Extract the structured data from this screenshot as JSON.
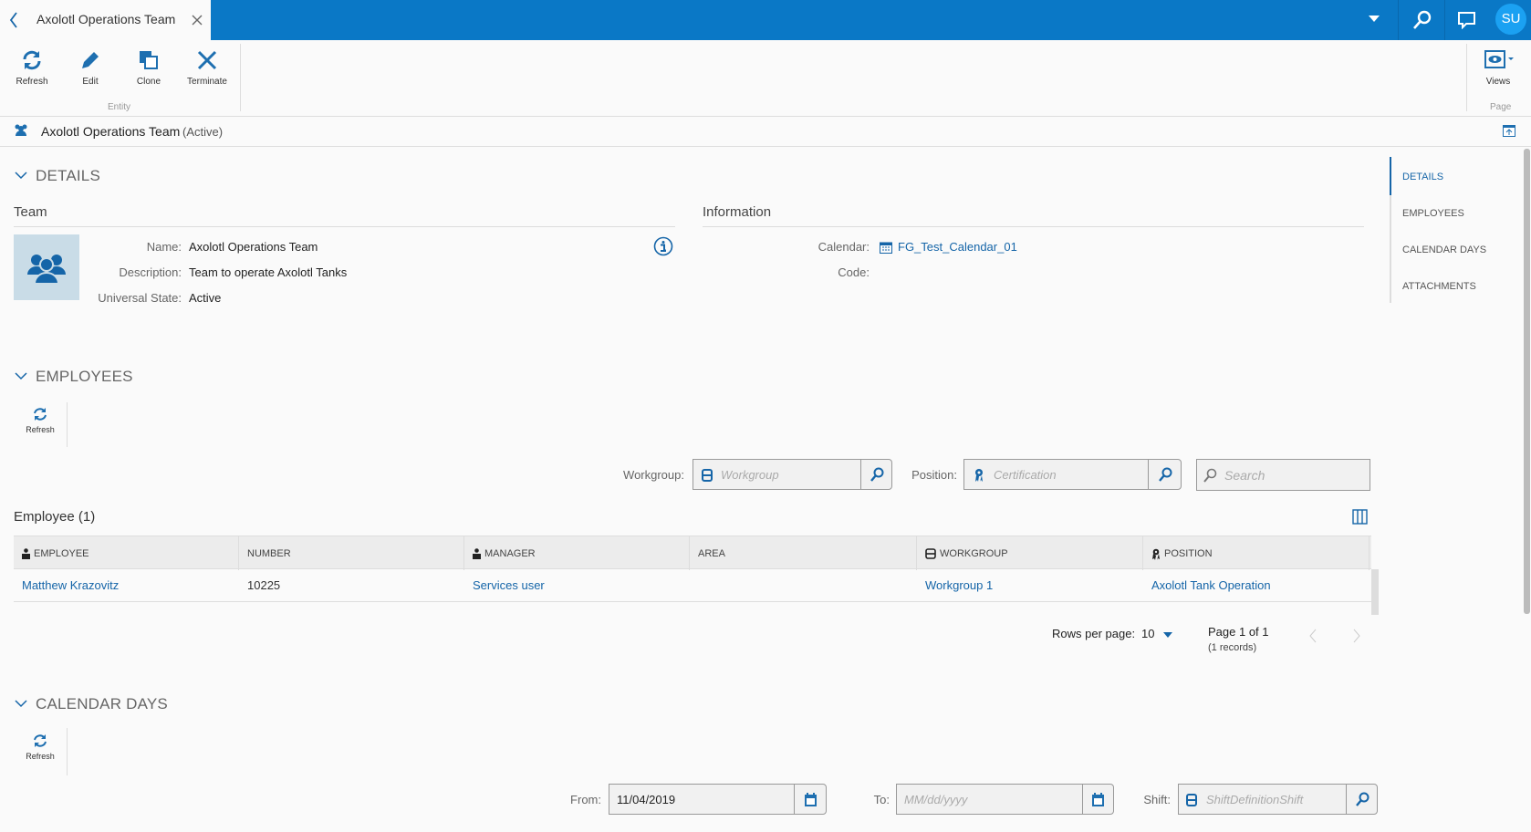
{
  "tab": {
    "title": "Axolotl Operations Team"
  },
  "user": {
    "initials": "SU"
  },
  "toolbar": {
    "refresh": "Refresh",
    "edit": "Edit",
    "clone": "Clone",
    "terminate": "Terminate",
    "entity_group": "Entity",
    "views": "Views",
    "page_group": "Page"
  },
  "header": {
    "title": "Axolotl Operations Team",
    "state": "(Active)"
  },
  "details": {
    "heading": "DETAILS",
    "team_heading": "Team",
    "info_heading": "Information",
    "name_label": "Name:",
    "name": "Axolotl Operations Team",
    "description_label": "Description:",
    "description": "Team to operate Axolotl Tanks",
    "state_label": "Universal State:",
    "state": "Active",
    "calendar_label": "Calendar:",
    "calendar": "FG_Test_Calendar_01",
    "code_label": "Code:"
  },
  "nav": {
    "items": [
      "DETAILS",
      "EMPLOYEES",
      "CALENDAR DAYS",
      "ATTACHMENTS"
    ]
  },
  "employees": {
    "heading": "EMPLOYEES",
    "refresh": "Refresh",
    "workgroup_label": "Workgroup:",
    "workgroup_placeholder": "Workgroup",
    "position_label": "Position:",
    "position_placeholder": "Certification",
    "search_placeholder": "Search",
    "table_title": "Employee (1)",
    "columns": [
      "EMPLOYEE",
      "NUMBER",
      "MANAGER",
      "AREA",
      "WORKGROUP",
      "POSITION"
    ],
    "rows": [
      [
        "Matthew Krazovitz",
        "10225",
        "Services user",
        "",
        "Workgroup 1",
        "Axolotl Tank Operation"
      ]
    ],
    "rows_per_page_label": "Rows per page:",
    "rows_per_page": "10",
    "page_info": "Page 1 of 1",
    "records": "(1 records)"
  },
  "calendar_days": {
    "heading": "CALENDAR DAYS",
    "refresh": "Refresh",
    "from_label": "From:",
    "from_value": "11/04/2019",
    "to_label": "To:",
    "to_placeholder": "MM/dd/yyyy",
    "shift_label": "Shift:",
    "shift_placeholder": "ShiftDefinitionShift"
  }
}
